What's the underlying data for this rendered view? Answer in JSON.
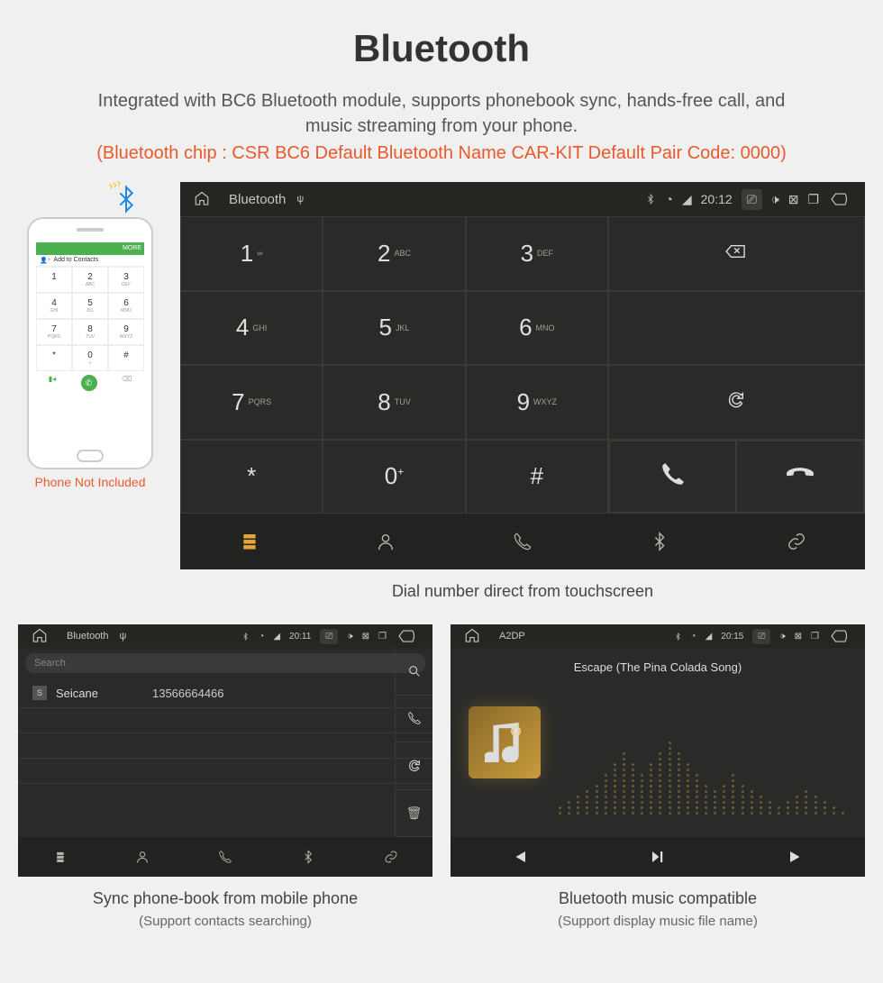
{
  "title": "Bluetooth",
  "subtitle": "Integrated with BC6 Bluetooth module, supports phonebook sync, hands-free call, and music streaming from your phone.",
  "spec": "(Bluetooth chip : CSR BC6     Default Bluetooth Name CAR-KIT     Default Pair Code: 0000)",
  "phone": {
    "header_more": "MORE",
    "add_contacts": "Add to Contacts",
    "caption": "Phone Not Included",
    "keys": [
      {
        "n": "1",
        "s": ""
      },
      {
        "n": "2",
        "s": "ABC"
      },
      {
        "n": "3",
        "s": "DEF"
      },
      {
        "n": "4",
        "s": "GHI"
      },
      {
        "n": "5",
        "s": "JKL"
      },
      {
        "n": "6",
        "s": "MNO"
      },
      {
        "n": "7",
        "s": "PQRS"
      },
      {
        "n": "8",
        "s": "TUV"
      },
      {
        "n": "9",
        "s": "WXYZ"
      },
      {
        "n": "*",
        "s": ""
      },
      {
        "n": "0",
        "s": "+"
      },
      {
        "n": "#",
        "s": ""
      }
    ]
  },
  "dialer": {
    "sb_title": "Bluetooth",
    "sb_time": "20:12",
    "caption": "Dial number direct from touchscreen",
    "keys": [
      {
        "n": "1",
        "s": "∞"
      },
      {
        "n": "2",
        "s": "ABC"
      },
      {
        "n": "3",
        "s": "DEF"
      },
      {
        "n": "4",
        "s": "GHI"
      },
      {
        "n": "5",
        "s": "JKL"
      },
      {
        "n": "6",
        "s": "MNO"
      },
      {
        "n": "7",
        "s": "PQRS"
      },
      {
        "n": "8",
        "s": "TUV"
      },
      {
        "n": "9",
        "s": "WXYZ"
      },
      {
        "n": "*",
        "s": ""
      },
      {
        "n": "0",
        "s": "+",
        "sup": true
      },
      {
        "n": "#",
        "s": ""
      }
    ]
  },
  "phonebook": {
    "sb_title": "Bluetooth",
    "sb_time": "20:11",
    "search_placeholder": "Search",
    "contact_name": "Seicane",
    "contact_number": "13566664466",
    "badge": "S",
    "caption1": "Sync phone-book from mobile phone",
    "caption2": "(Support contacts searching)"
  },
  "a2dp": {
    "sb_title": "A2DP",
    "sb_time": "20:15",
    "song": "Escape (The Pina Colada Song)",
    "caption1": "Bluetooth music compatible",
    "caption2": "(Support display music file name)"
  }
}
